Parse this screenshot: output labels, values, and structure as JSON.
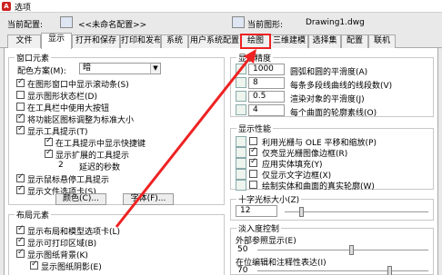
{
  "window": {
    "title": "选项"
  },
  "profile": {
    "current_config_label": "当前配置:",
    "current_config_value": "<<未命名配置>>",
    "current_drawing_label": "当前图形:",
    "current_drawing_value": "Drawing1.dwg"
  },
  "tabs": [
    "文件",
    "显示",
    "打开和保存",
    "打印和发布",
    "系统",
    "用户系统配置",
    "绘图",
    "三维建模",
    "选择集",
    "配置",
    "联机"
  ],
  "window_elements": {
    "group_title": "窗口元素",
    "color_scheme_label": "配色方案(M):",
    "color_scheme_value": "暗",
    "cb_scrollbars": "在图形窗口中显示滚动条(S)",
    "cb_status_bar": "显示图形状态栏(D)",
    "cb_large_buttons": "在工具栏中使用大按钮",
    "cb_resize_icons": "将功能区图标调整为标准大小",
    "cb_tooltips": "显示工具提示(T)",
    "cb_shortcut_keys": "在工具提示中显示快捷键",
    "cb_extended_tips": "显示扩展的工具提示",
    "delay_value": "2",
    "delay_label": "延迟的秒数",
    "cb_rollover": "显示鼠标悬停工具提示",
    "cb_file_tabs": "显示文件选项卡(S)",
    "btn_colors": "颜色(C)...",
    "btn_fonts": "字体(F)..."
  },
  "layout_elements": {
    "group_title": "布局元素",
    "cb_layout_tabs": "显示布局和模型选项卡(L)",
    "cb_printable_area": "显示可打印区域(B)",
    "cb_paper_bg": "显示图纸背景(K)",
    "cb_paper_shadow": "显示图纸阴影(E)"
  },
  "resolution": {
    "group_title": "显示精度",
    "rows": [
      {
        "value": "1000",
        "label": "圆弧和圆的平滑度(A)"
      },
      {
        "value": "8",
        "label": "每条多段线曲线的线段数(V)"
      },
      {
        "value": "0.5",
        "label": "渲染对象的平滑度(J)"
      },
      {
        "value": "4",
        "label": "每个曲面的轮廓素线(O)"
      }
    ]
  },
  "performance": {
    "group_title": "显示性能",
    "items": [
      {
        "label": "利用光栅与 OLE 平移和缩放(P)",
        "checked": false
      },
      {
        "label": "仅亮显光栅图像边框(R)",
        "checked": true
      },
      {
        "label": "应用实体填充(Y)",
        "checked": true
      },
      {
        "label": "仅显示文字边框(X)",
        "checked": false
      },
      {
        "label": "绘制实体和曲面的真实轮廓(W)",
        "checked": false
      }
    ]
  },
  "crosshair": {
    "group_title": "十字光标大小(Z)",
    "value": "12",
    "level": 12
  },
  "fade": {
    "group_title": "淡入度控制",
    "xref_label": "外部参照显示(E)",
    "xref_value": "50",
    "xref_level": 50,
    "inplace_label": "在位编辑和注释性表达(I)",
    "inplace_value": "70",
    "inplace_level": 70
  },
  "colors": {
    "highlight": "#ee2222",
    "active_tab_bg": "#ffffff"
  }
}
